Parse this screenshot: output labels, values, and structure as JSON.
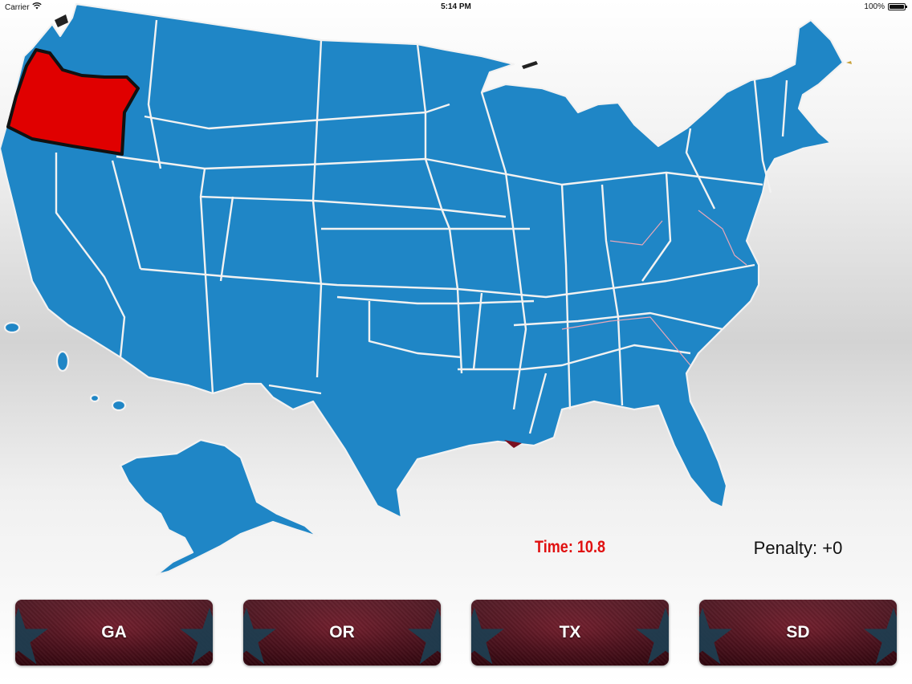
{
  "status_bar": {
    "carrier": "Carrier",
    "time": "5:14 PM",
    "battery": "100%"
  },
  "game": {
    "timer_text": "Time: 10.8",
    "penalty_text": "Penalty: +0",
    "highlighted_state": "Oregon",
    "choices": [
      {
        "label": "GA"
      },
      {
        "label": "OR"
      },
      {
        "label": "TX"
      },
      {
        "label": "SD"
      }
    ]
  },
  "colors": {
    "state_fill": "#1f86c6",
    "state_border": "#f2f2f2",
    "highlight_fill": "#e00000",
    "highlight_border": "#111111",
    "timer_color": "#e01010",
    "button_base": "#5a0f1d",
    "button_star": "#1d3f52"
  }
}
